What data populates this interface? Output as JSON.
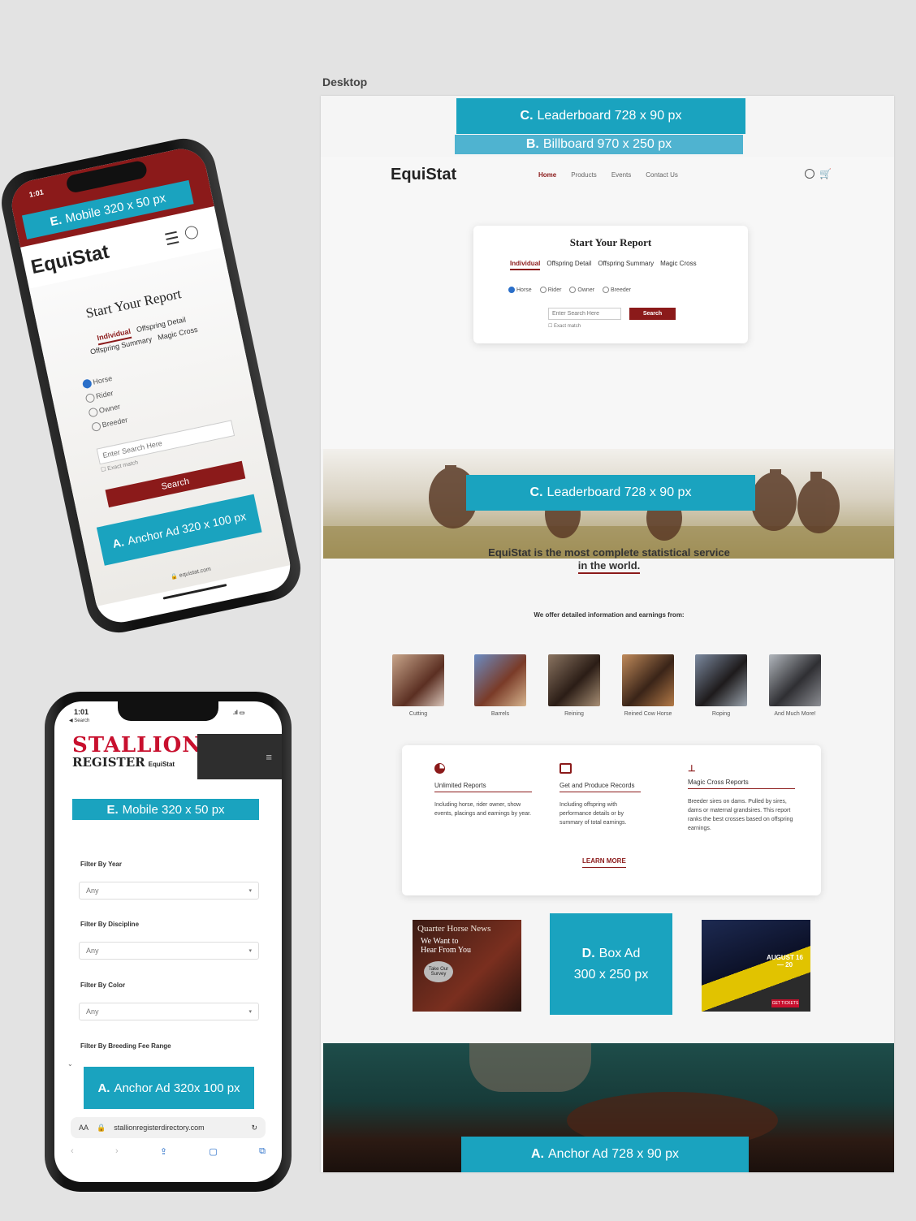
{
  "desktop_label": "Desktop",
  "ads": {
    "leaderboard_top": {
      "letter": "C.",
      "text": "Leaderboard 728 x 90 px"
    },
    "billboard": {
      "letter": "B.",
      "text": "Billboard 970 x 250 px"
    },
    "leaderboard_mid": {
      "letter": "C.",
      "text": "Leaderboard 728 x 90 px"
    },
    "box_ad": {
      "letter": "D.",
      "text1": "Box Ad",
      "text2": "300 x 250 px"
    },
    "anchor_desktop": {
      "letter": "A.",
      "text": "Anchor Ad 728 x 90 px"
    },
    "phone1_mobile": {
      "letter": "E.",
      "text": "Mobile 320 x 50 px"
    },
    "phone1_anchor": {
      "letter": "A.",
      "text": "Anchor Ad 320 x 100 px"
    },
    "phone2_mobile": {
      "letter": "E.",
      "text": "Mobile 320 x 50 px"
    },
    "phone2_anchor": {
      "letter": "A.",
      "text": "Anchor Ad 320x 100 px"
    }
  },
  "desktop": {
    "logo": "EquiStat",
    "nav": [
      "Home",
      "Products",
      "Events",
      "Contact Us"
    ],
    "report": {
      "title": "Start Your Report",
      "tabs": [
        "Individual",
        "Offspring Detail",
        "Offspring Summary",
        "Magic Cross"
      ],
      "radios": [
        "Horse",
        "Rider",
        "Owner",
        "Breeder"
      ],
      "placeholder": "Enter Search Here",
      "search_button": "Search",
      "exact_match": "Exact match"
    },
    "headline_1": "EquiStat is the most complete statistical service",
    "headline_2": "in the world.",
    "subhead": "We offer detailed information and earnings from:",
    "disciplines": [
      "Cutting",
      "Barrels",
      "Reining",
      "Reined Cow Horse",
      "Roping",
      "And Much More!"
    ],
    "features": [
      {
        "title": "Unlimited Reports",
        "text": "Including horse, rider owner, show events, placings and earnings by year."
      },
      {
        "title": "Get and Produce Records",
        "text": "Including offspring with performance details or by summary of total earnings."
      },
      {
        "title": "Magic Cross Reports",
        "text": "Breeder sires on dams. Pulled by sires, dams or maternal grandsires. This report ranks the best crosses based on offspring earnings."
      }
    ],
    "learn_more": "LEARN MORE",
    "qhn_ad": {
      "title": "Quarter Horse News",
      "line1": "We Want to",
      "line2": "Hear From You",
      "cta": "Take Our Survey"
    },
    "event_ad": {
      "dates": "AUGUST 16 — 20",
      "cta": "GET TICKETS"
    }
  },
  "phone1": {
    "time": "1:01",
    "logo": "EquiStat",
    "title": "Start Your Report",
    "tabs": [
      "Individual",
      "Offspring Detail",
      "Offspring Summary",
      "Magic Cross"
    ],
    "radios": [
      "Horse",
      "Rider",
      "Owner",
      "Breeder"
    ],
    "placeholder": "Enter Search Here",
    "exact_match": "Exact match",
    "search_button": "Search",
    "url": "equistat.com"
  },
  "phone2": {
    "time": "1:01",
    "back": "Search",
    "logo_line1": "STALLION",
    "logo_line2": "REGISTER",
    "logo_small": "EquiStat",
    "filters": [
      {
        "label": "Filter By Year",
        "value": "Any"
      },
      {
        "label": "Filter By Discipline",
        "value": "Any"
      },
      {
        "label": "Filter By Color",
        "value": "Any"
      },
      {
        "label": "Filter By Breeding Fee Range",
        "value": ""
      }
    ],
    "url": "stallionregisterdirectory.com",
    "aa": "AA"
  },
  "colors": {
    "ad_blue": "#1aa3bf",
    "brand_red": "#8b1a1a",
    "stallion_red": "#c8102e"
  }
}
